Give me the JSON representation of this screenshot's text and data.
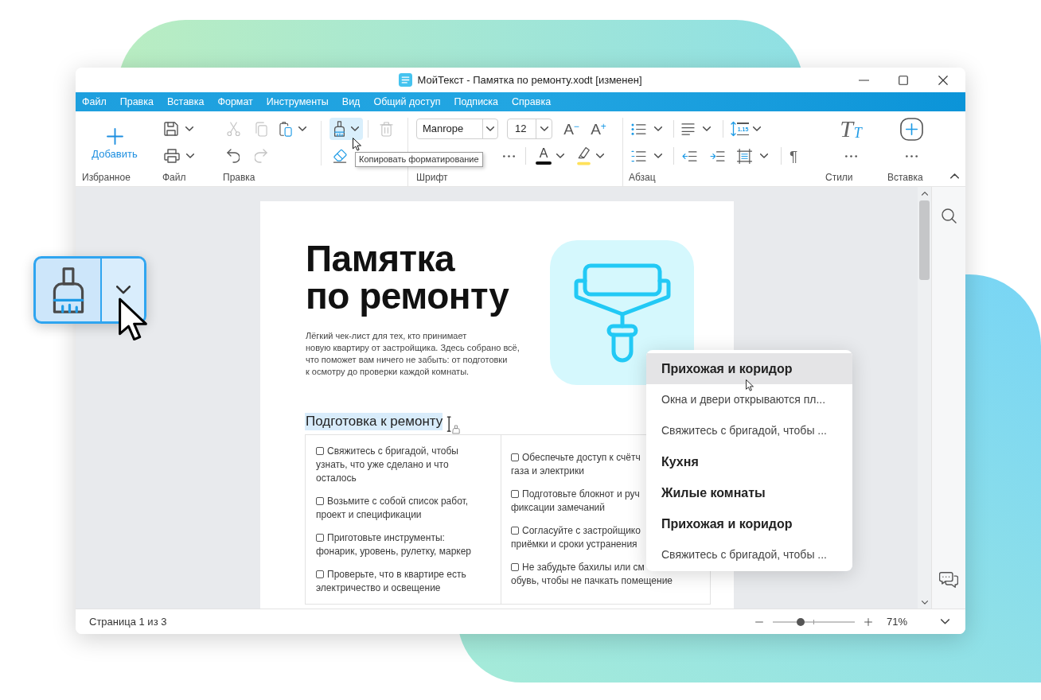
{
  "window": {
    "title": "МойТекст - Памятка по ремонту.xodt [изменен]"
  },
  "menu_bar": [
    "Файл",
    "Правка",
    "Вставка",
    "Формат",
    "Инструменты",
    "Вид",
    "Общий доступ",
    "Подписка",
    "Справка"
  ],
  "ribbon": {
    "favorites": {
      "label": "Избранное",
      "add_button": "Добавить"
    },
    "file": {
      "label": "Файл"
    },
    "edit": {
      "label": "Правка",
      "cut": {
        "disabled": true
      },
      "copy": {
        "disabled": true
      },
      "paste": {
        "disabled": false
      },
      "undo": {
        "disabled": false
      },
      "redo": {
        "disabled": true
      }
    },
    "format_painter": {
      "active": true
    },
    "delete": {
      "disabled": true
    },
    "font": {
      "label": "Шрифт",
      "family": "Manrope",
      "size": "12",
      "shrink_button": "A$^{−}$",
      "grow_button": "A$^{+}$",
      "color_button": "A"
    },
    "paragraph": {
      "label": "Абзац",
      "line_spacing": "1.15",
      "pilcrow": "¶"
    },
    "styles": {
      "label": "Стили",
      "letter": "T",
      "small_letter": "T"
    },
    "insert": {
      "label": "Вставка"
    }
  },
  "tooltip": "Копировать форматирование",
  "document": {
    "title": "Памятка\nпо ремонту",
    "intro": "Лёгкий чек-лист для тех, кто принимает\nновую квартиру от застройщика. Здесь собрано всё,\nчто поможет вам ничего не забыть: от подготовки\nк осмотру до проверки каждой комнаты.",
    "section_heading": {
      "text": "Подготовка к ремонту",
      "selected": true
    },
    "checklist": [
      [
        {
          "text": "Свяжитесь с бригадой, чтобы\nузнать, что уже сделано и что\nосталось",
          "checked": false
        },
        {
          "text": "Возьмите с собой список работ,\nпроект и спецификации",
          "checked": false
        },
        {
          "text": "Приготовьте инструменты:\nфонарик, уровень, рулетку, маркер",
          "checked": false
        },
        {
          "text": "Проверьте, что в квартире есть\nэлектричество и освещение",
          "checked": false
        }
      ],
      [
        {
          "text": "Обеспечьте доступ к счётч\nгаза и электрики",
          "checked": false
        },
        {
          "text": "Подготовьте блокнот и руч\nфиксации замечаний",
          "checked": false
        },
        {
          "text": "Согласуйте с застройщико\nприёмки и сроки устранения",
          "checked": false
        },
        {
          "text": "Не забудьте бахилы или см\nобувь, чтобы не пачкать помещение",
          "checked": false
        }
      ]
    ]
  },
  "heading_menu": [
    {
      "kind": "heading",
      "text": "Прихожая и коридор",
      "selected": true
    },
    {
      "kind": "text",
      "text": "Окна и двери открываются пл...",
      "selected": false
    },
    {
      "kind": "text",
      "text": "Свяжитесь с бригадой, чтобы ...",
      "selected": false
    },
    {
      "kind": "heading",
      "text": "Кухня",
      "selected": false
    },
    {
      "kind": "heading",
      "text": "Жилые комнаты",
      "selected": false
    },
    {
      "kind": "heading",
      "text": "Прихожая и коридор",
      "selected": false
    },
    {
      "kind": "text",
      "text": "Свяжитесь с бригадой, чтобы ...",
      "selected": false
    }
  ],
  "status_bar": {
    "page": "Страница 1 из 3",
    "zoom": {
      "level": 0.34,
      "value": "71%"
    }
  },
  "callout": {
    "active": true
  }
}
